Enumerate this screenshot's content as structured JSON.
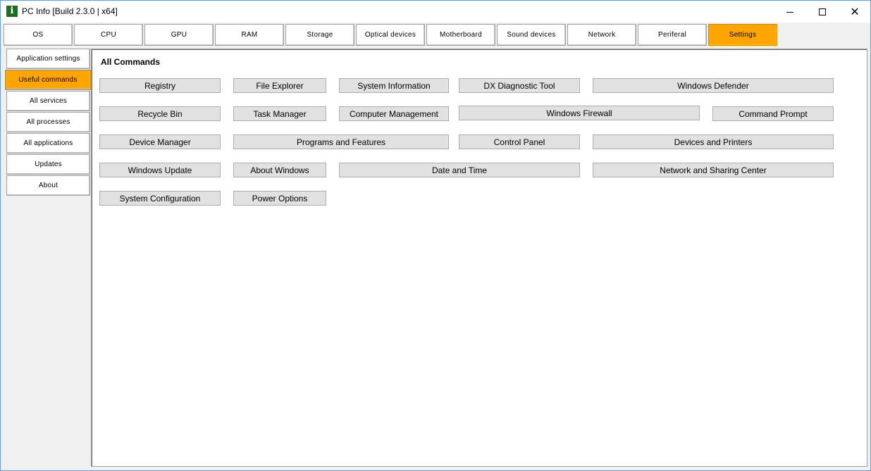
{
  "window": {
    "title": "PC Info [Build 2.3.0 | x64]",
    "icon": "info-icon",
    "controls": {
      "minimize": "minimize-icon",
      "maximize": "maximize-icon",
      "close": "close-icon"
    }
  },
  "tabs": [
    {
      "label": "OS"
    },
    {
      "label": "CPU"
    },
    {
      "label": "GPU"
    },
    {
      "label": "RAM"
    },
    {
      "label": "Storage"
    },
    {
      "label": "Optical devices"
    },
    {
      "label": "Motherboard"
    },
    {
      "label": "Sound devices"
    },
    {
      "label": "Network"
    },
    {
      "label": "Periferal"
    },
    {
      "label": "Settings",
      "active": true
    }
  ],
  "sidebar": {
    "items": [
      {
        "label": "Application settings"
      },
      {
        "label": "Useful commands",
        "active": true
      },
      {
        "label": "All services"
      },
      {
        "label": "All processes"
      },
      {
        "label": "All applications"
      },
      {
        "label": "Updates"
      },
      {
        "label": "About"
      }
    ]
  },
  "main": {
    "section_title": "All Commands",
    "commands": [
      {
        "label": "Registry"
      },
      {
        "label": "File Explorer"
      },
      {
        "label": "System Information"
      },
      {
        "label": "DX Diagnostic Tool"
      },
      {
        "label": "Windows Defender"
      },
      {
        "label": "Recycle Bin"
      },
      {
        "label": "Task Manager"
      },
      {
        "label": "Computer Management"
      },
      {
        "label": "Windows Firewall"
      },
      {
        "label": "Command Prompt"
      },
      {
        "label": "Device Manager"
      },
      {
        "label": "Programs and Features"
      },
      {
        "label": "Control Panel"
      },
      {
        "label": "Devices and Printers"
      },
      {
        "label": "Windows Update"
      },
      {
        "label": "About Windows"
      },
      {
        "label": "Date and Time"
      },
      {
        "label": "Network and Sharing Center"
      },
      {
        "label": "System Configuration"
      },
      {
        "label": "Power Options"
      }
    ]
  },
  "colors": {
    "accent": "#ffa500",
    "button_face": "#e1e1e1",
    "window_border": "#6c9bd2"
  }
}
